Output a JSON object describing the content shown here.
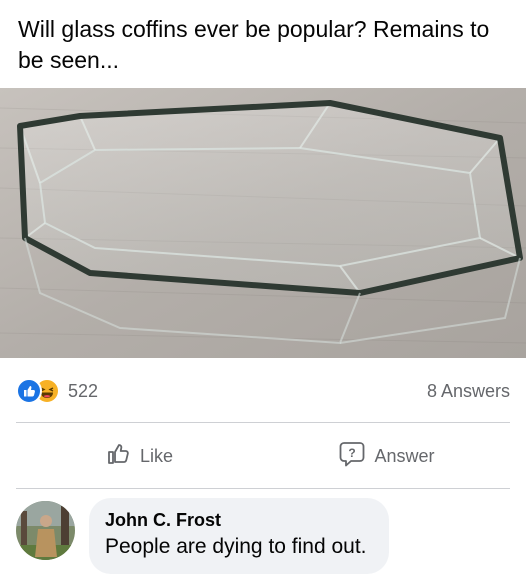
{
  "post": {
    "text": "Will glass coffins ever be popular? Remains to be seen..."
  },
  "photo": {
    "subject": "glass coffin on carpet"
  },
  "reactions": {
    "icons": [
      "like-icon",
      "haha-icon"
    ],
    "count": "522",
    "answers": "8 Answers"
  },
  "actions": {
    "like_label": "Like",
    "answer_label": "Answer"
  },
  "comment": {
    "author": "John C. Frost",
    "text": "People are dying to find out."
  },
  "colors": {
    "brand_blue": "#1b74e4",
    "haha_yellow": "#f7b125",
    "muted_text": "#65676b",
    "bubble_bg": "#f0f2f5"
  }
}
